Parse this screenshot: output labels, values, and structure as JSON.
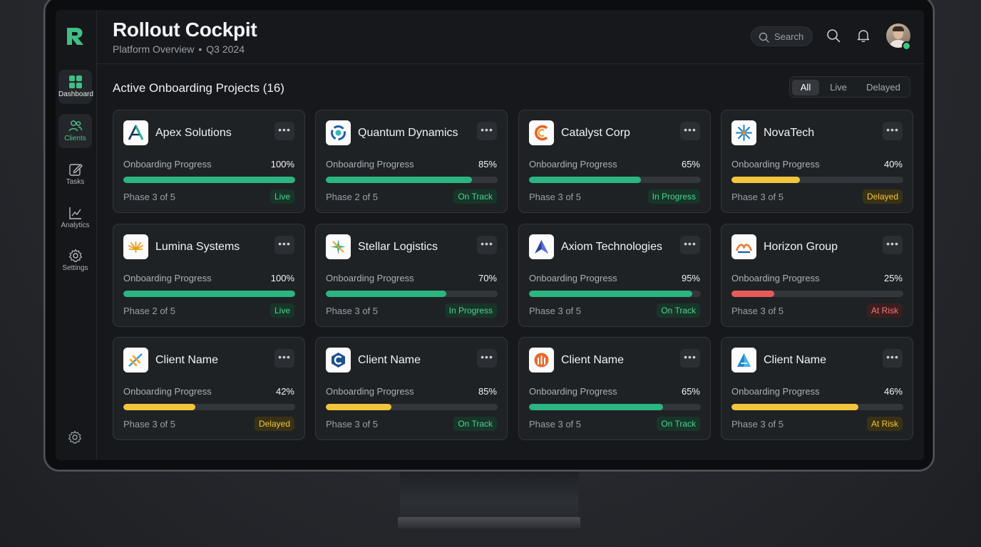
{
  "app": {
    "title": "Rollout Cockpit",
    "subtitle_left": "Platform Overview",
    "subtitle_sep": "•",
    "subtitle_right": "Q3 2024"
  },
  "sidebar": {
    "items": [
      {
        "label": "Dashboard",
        "icon": "grid-icon"
      },
      {
        "label": "Clients",
        "icon": "users-icon"
      },
      {
        "label": "Tasks",
        "icon": "edit-icon"
      },
      {
        "label": "Analytics",
        "icon": "chart-icon"
      },
      {
        "label": "Settings",
        "icon": "gear-icon"
      }
    ]
  },
  "header": {
    "search_placeholder": "Search"
  },
  "section": {
    "title": "Active Onboarding Projects (16)",
    "filters": [
      "All",
      "Live",
      "Delayed"
    ],
    "active_filter": "All"
  },
  "colors": {
    "green": "#2bb581",
    "yellow": "#f2c53d",
    "red": "#e85a58",
    "accent": "#4cc38a"
  },
  "progress_label": "Onboarding Progress",
  "cards": [
    {
      "name": "Apex Solutions",
      "progress_text": "100%",
      "progress": 100,
      "color": "green",
      "phase": "Phase 3 of 5",
      "status": "Live",
      "status_color": "green"
    },
    {
      "name": "Quantum Dynamics",
      "progress_text": "85%",
      "progress": 85,
      "color": "green",
      "phase": "Phase 2 of 5",
      "status": "On Track",
      "status_color": "green"
    },
    {
      "name": "Catalyst Corp",
      "progress_text": "65%",
      "progress": 65,
      "color": "green",
      "phase": "Phase 3 of 5",
      "status": "In Progress",
      "status_color": "green"
    },
    {
      "name": "NovaTech",
      "progress_text": "40%",
      "progress": 40,
      "color": "yellow",
      "phase": "Phase 3 of 5",
      "status": "Delayed",
      "status_color": "yellow"
    },
    {
      "name": "Lumina Systems",
      "progress_text": "100%",
      "progress": 100,
      "color": "green",
      "phase": "Phase 2 of 5",
      "status": "Live",
      "status_color": "green"
    },
    {
      "name": "Stellar Logistics",
      "progress_text": "70%",
      "progress": 70,
      "color": "green",
      "phase": "Phase 3 of 5",
      "status": "In Progress",
      "status_color": "green"
    },
    {
      "name": "Axiom Technologies",
      "progress_text": "95%",
      "progress": 95,
      "color": "green",
      "phase": "Phase 3 of 5",
      "status": "On Track",
      "status_color": "green"
    },
    {
      "name": "Horizon Group",
      "progress_text": "25%",
      "progress": 25,
      "color": "red",
      "phase": "Phase 3 of 5",
      "status": "At Risk",
      "status_color": "red"
    },
    {
      "name": "Client Name",
      "progress_text": "42%",
      "progress": 42,
      "color": "yellow",
      "phase": "Phase 3 of 5",
      "status": "Delayed",
      "status_color": "yellow"
    },
    {
      "name": "Client Name",
      "progress_text": "85%",
      "progress": 38,
      "color": "yellow",
      "phase": "Phase 3 of 5",
      "status": "On Track",
      "status_color": "green"
    },
    {
      "name": "Client Name",
      "progress_text": "65%",
      "progress": 78,
      "color": "green",
      "phase": "Phase 3 of 5",
      "status": "On Track",
      "status_color": "green"
    },
    {
      "name": "Client Name",
      "progress_text": "46%",
      "progress": 74,
      "color": "yellow",
      "phase": "Phase 3 of 5",
      "status": "At Risk",
      "status_color": "yellow"
    }
  ]
}
